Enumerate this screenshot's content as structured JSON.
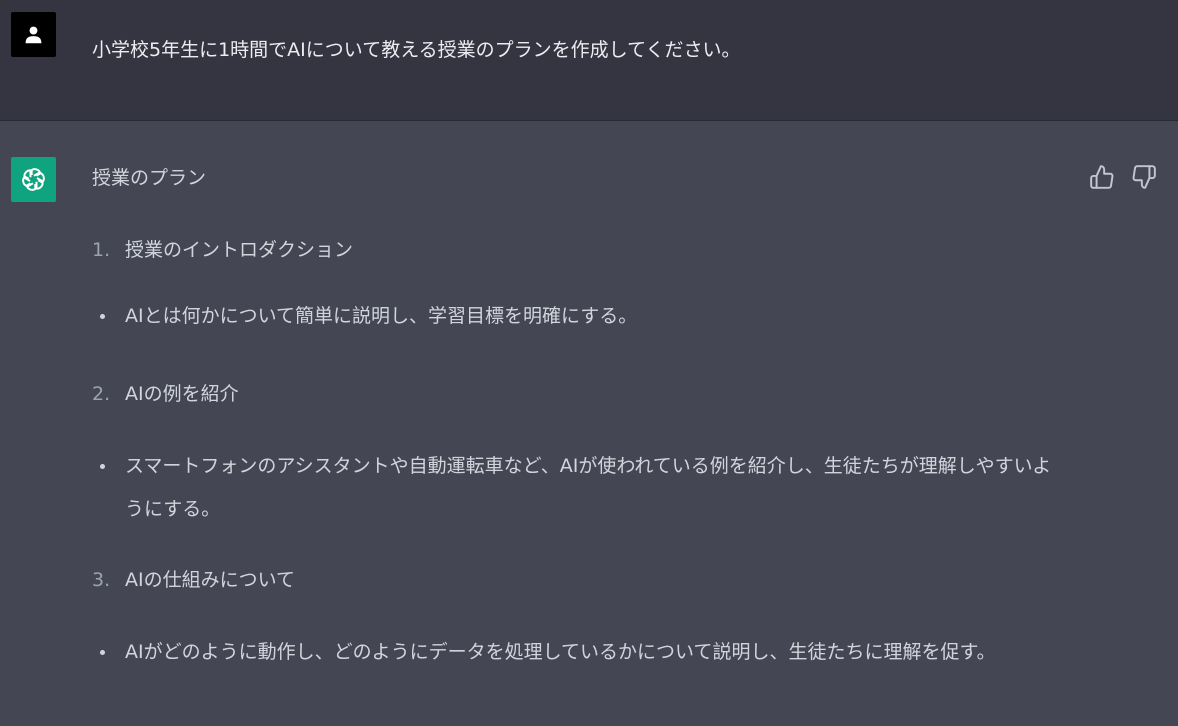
{
  "user": {
    "avatar_icon": "user-icon",
    "message": "小学校5年生に1時間でAIについて教える授業のプランを作成してください。"
  },
  "assistant": {
    "avatar_icon": "openai-logo-icon",
    "heading": "授業のプラン",
    "feedback": {
      "up_icon": "thumbs-up-icon",
      "down_icon": "thumbs-down-icon"
    },
    "items": [
      {
        "number": "1.",
        "title": "授業のイントロダクション",
        "bullet": "AIとは何かについて簡単に説明し、学習目標を明確にする。"
      },
      {
        "number": "2.",
        "title": "AIの例を紹介",
        "bullet": "スマートフォンのアシスタントや自動運転車など、AIが使われている例を紹介し、生徒たちが理解しやすいようにする。"
      },
      {
        "number": "3.",
        "title": "AIの仕組みについて",
        "bullet": "AIがどのように動作し、どのようにデータを処理しているかについて説明し、生徒たちに理解を促す。"
      }
    ]
  },
  "colors": {
    "user_bg": "#343541",
    "assistant_bg": "#444654",
    "brand_green": "#10a37f"
  }
}
